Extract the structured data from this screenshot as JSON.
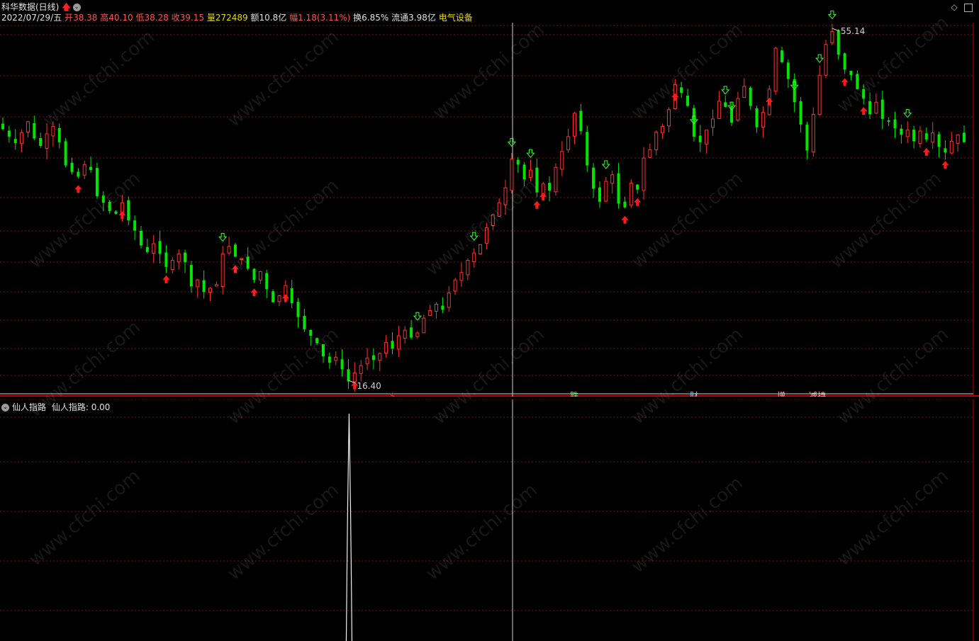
{
  "header": {
    "stock_name": "科华数据(日线)",
    "signal_icon": "red-up-arrow-icon",
    "date": "2022/07/29/五",
    "open_label": "开",
    "open_value": "38.38",
    "high_label": "高",
    "high_value": "40.10",
    "low_label": "低",
    "low_value": "38.28",
    "close_label": "收",
    "close_value": "39.15",
    "volume_label": "量",
    "volume_value": "272489",
    "amount_label": "额",
    "amount_value": "10.8亿",
    "change_label": "幅",
    "change_value": "1.18(3.11%)",
    "turnover_label": "换",
    "turnover_value": "6.85%",
    "float_label": "流通",
    "float_value": "3.98亿",
    "sector": "电气设备"
  },
  "indicator": {
    "name": "仙人指路",
    "readout": "仙人指路: 0.00"
  },
  "annotations": {
    "high_price": "55.14",
    "low_price": "16.40"
  },
  "event_markers": [
    {
      "text": "$",
      "color": "#ff3030"
    },
    {
      "text": "跌",
      "color": "#70ff70"
    },
    {
      "text": "财",
      "color": "#80c8ff"
    },
    {
      "text": "增",
      "color": "#ffb0b0"
    },
    {
      "text": "减持",
      "color": "#ffb0b0"
    }
  ],
  "watermark": "www.cfchi.com",
  "colors": {
    "up": "#ff3030",
    "down": "#00e600",
    "grid": "#7a1010",
    "divider": "#c00000",
    "crosshair": "#d0d0d0",
    "label_red": "#ff5050",
    "label_yellow": "#e6d800",
    "label_green": "#00e600",
    "sector": "#e6d800"
  },
  "window_controls": [
    "diamond-icon",
    "maximize-icon"
  ],
  "chart_data": {
    "type": "candlestick",
    "title": "科华数据(日线)",
    "period": "daily",
    "price_range_visible": [
      16.4,
      55.14
    ],
    "series": [
      {
        "name": "close",
        "values": [
          44.0,
          43.2,
          42.5,
          43.6,
          44.8,
          43.0,
          42.2,
          43.5,
          44.3,
          42.6,
          40.1,
          39.4,
          38.9,
          40.2,
          39.6,
          36.8,
          36.1,
          35.2,
          34.9,
          36.1,
          34.2,
          33.1,
          31.5,
          30.8,
          31.7,
          30.6,
          29.2,
          29.9,
          30.6,
          29.7,
          27.1,
          27.8,
          26.5,
          26.9,
          27.3,
          30.6,
          31.4,
          30.3,
          30.1,
          29.0,
          27.8,
          28.7,
          26.8,
          25.4,
          26.1,
          27.2,
          25.3,
          23.8,
          22.5,
          21.8,
          21.0,
          19.6,
          18.9,
          19.5,
          18.2,
          16.9,
          17.8,
          18.6,
          19.4,
          19.2,
          19.9,
          21.1,
          20.4,
          21.8,
          22.4,
          21.6,
          22.1,
          23.7,
          24.5,
          25.2,
          24.6,
          26.4,
          27.8,
          28.6,
          29.9,
          30.7,
          31.6,
          33.4,
          34.8,
          36.1,
          37.7,
          40.8,
          40.2,
          38.6,
          39.6,
          37.2,
          38.1,
          37.4,
          39.9,
          41.6,
          43.2,
          45.7,
          43.8,
          40.1,
          37.6,
          36.2,
          38.4,
          39.1,
          36.0,
          35.6,
          38.2,
          37.5,
          40.9,
          41.8,
          43.7,
          44.3,
          46.1,
          48.8,
          47.9,
          46.5,
          43.2,
          42.6,
          43.9,
          45.1,
          47.0,
          46.4,
          44.7,
          47.3,
          48.6,
          46.5,
          44.2,
          45.8,
          48.3,
          52.7,
          51.2,
          49.4,
          46.9,
          44.5,
          41.7,
          45.6,
          49.8,
          53.1,
          54.5,
          52.0,
          50.4,
          49.8,
          48.3,
          47.3,
          45.6,
          46.9,
          45.1,
          44.8,
          44.1,
          43.4,
          43.9,
          42.7,
          43.8,
          42.9,
          43.6,
          42.1,
          41.5,
          42.7,
          43.4,
          42.6
        ]
      }
    ],
    "annotations": [
      {
        "label": "55.14",
        "type": "period-high"
      },
      {
        "label": "16.40",
        "type": "period-low"
      }
    ],
    "indicator_panel": {
      "name": "仙人指路",
      "value": 0.0,
      "spike_count": 1
    },
    "grid": true
  }
}
